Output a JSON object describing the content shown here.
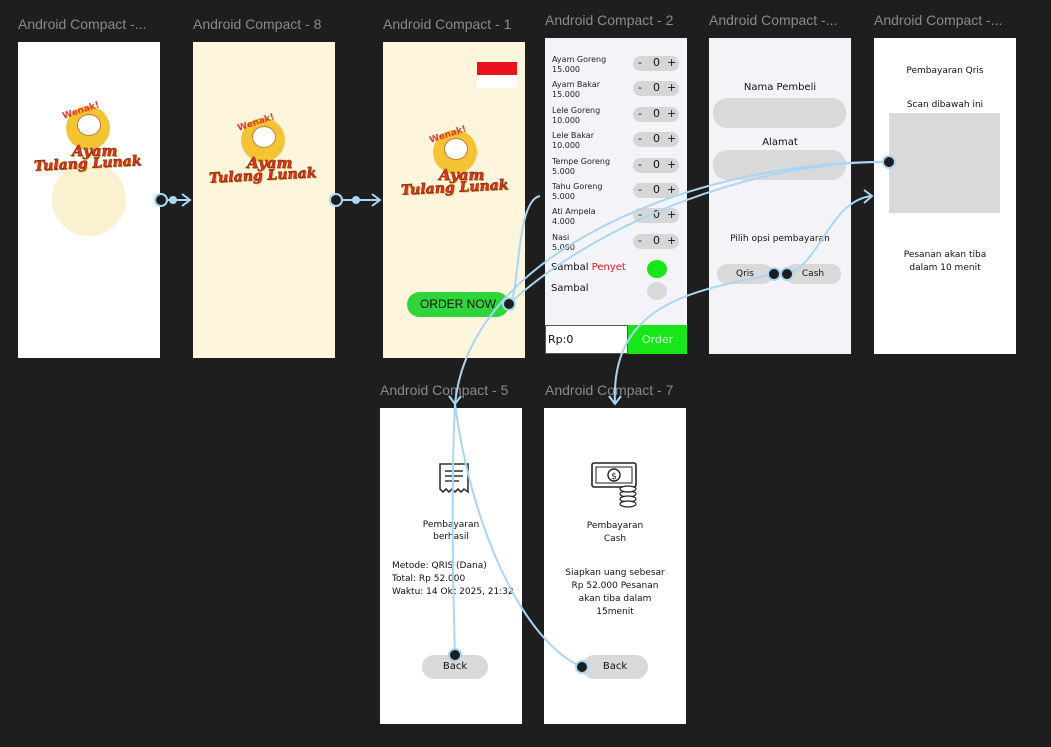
{
  "frames": {
    "f0_title": "Android Compact -...",
    "f8_title": "Android Compact - 8",
    "f1_title": "Android Compact - 1",
    "f2_title": "Android Compact - 2",
    "f3_title": "Android Compact -...",
    "f4_title": "Android Compact -...",
    "f5_title": "Android Compact - 5",
    "f7_title": "Android Compact - 7"
  },
  "logo": {
    "top": "Wenak!",
    "line1": "Ayam",
    "line2": "Tulang Lunak"
  },
  "splash": {
    "order_button": "ORDER NOW"
  },
  "menu": {
    "items": [
      {
        "name": "Ayam Goreng",
        "price": "15.000",
        "qty": "0"
      },
      {
        "name": "Ayam Bakar",
        "price": "15.000",
        "qty": "0"
      },
      {
        "name": "Lele Goreng",
        "price": "10.000",
        "qty": "0"
      },
      {
        "name": "Lele Bakar",
        "price": "10.000",
        "qty": "0"
      },
      {
        "name": "Tempe Goreng",
        "price": "5.000",
        "qty": "0"
      },
      {
        "name": "Tahu Goreng",
        "price": "5.000",
        "qty": "0"
      },
      {
        "name": "Ati Ampela",
        "price": "4.000",
        "qty": "0"
      },
      {
        "name": "Nasi",
        "price": "5.000",
        "qty": "0"
      }
    ],
    "minus": "-",
    "plus": "+",
    "sambal1_a": "Sambal",
    "sambal1_b": "Penyet",
    "sambal2": "Sambal",
    "total": "Rp:0",
    "order_button": "Order"
  },
  "form": {
    "name_label": "Nama Pembeli",
    "address_label": "Alamat",
    "payment_label": "Pilih opsi pembayaran",
    "qris_button": "Qris",
    "cash_button": "Cash"
  },
  "qris": {
    "title": "Pembayaran Qris",
    "scan": "Scan dibawah ini",
    "arrive_1": "Pesanan akan tiba",
    "arrive_2": "dalam 10 menit"
  },
  "success": {
    "title_1": "Pembayaran",
    "title_2": "berhasil",
    "method": "Metode: QRIS (Dana)",
    "total": "Total: Rp 52.000",
    "time": "Waktu: 14 Okt 2025, 21:32",
    "back": "Back"
  },
  "cash": {
    "title_1": "Pembayaran",
    "title_2": "Cash",
    "msg_1": "Siapkan uang sebesar",
    "msg_2": "Rp 52.000 Pesanan",
    "msg_3": "akan tiba dalam",
    "msg_4": "15menit",
    "back": "Back"
  },
  "colors": {
    "canvas": "#1e1e1e",
    "cream": "#fdf6dc",
    "green": "#2fd53a",
    "bright_green": "#19e619",
    "link": "#a9d6f5",
    "red_flag": "#e8131f"
  }
}
